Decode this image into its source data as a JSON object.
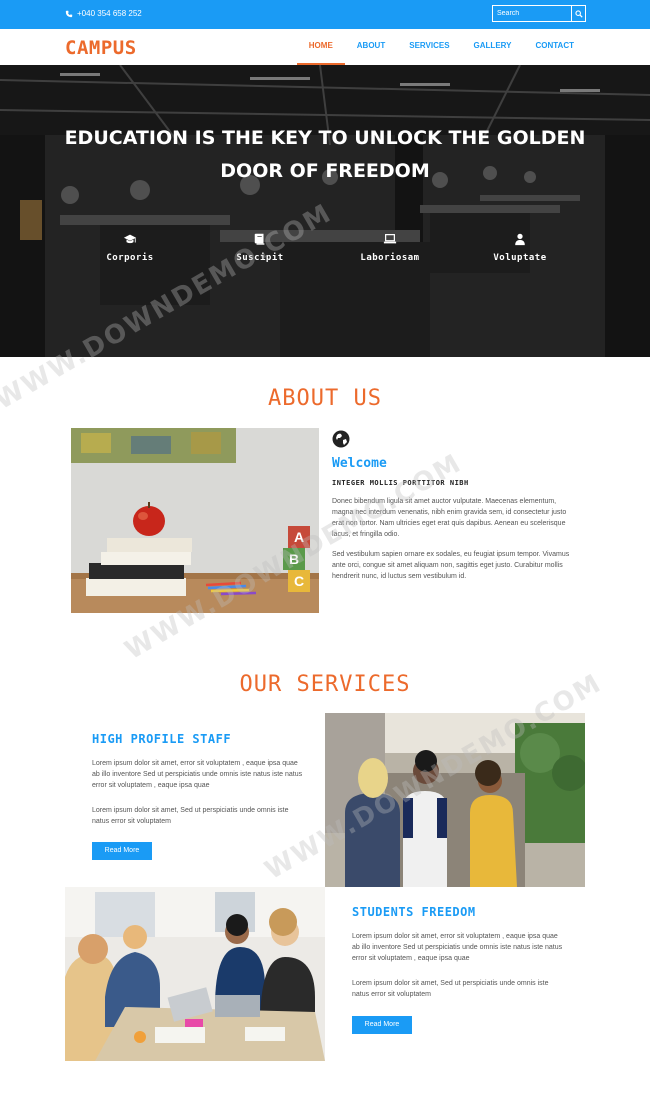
{
  "topbar": {
    "phone": "+040 354 658 252",
    "search_placeholder": "Search"
  },
  "brand": "CAMPUS",
  "nav": [
    {
      "label": "HOME",
      "active": true
    },
    {
      "label": "ABOUT",
      "active": false
    },
    {
      "label": "SERVICES",
      "active": false
    },
    {
      "label": "GALLERY",
      "active": false
    },
    {
      "label": "CONTACT",
      "active": false
    }
  ],
  "hero": {
    "title": "EDUCATION IS THE KEY TO UNLOCK THE GOLDEN DOOR OF FREEDOM",
    "features": [
      {
        "icon": "graduation-cap-icon",
        "label": "Corporis"
      },
      {
        "icon": "book-icon",
        "label": "Suscipit"
      },
      {
        "icon": "laptop-icon",
        "label": "Laboriosam"
      },
      {
        "icon": "user-icon",
        "label": "Voluptate"
      }
    ]
  },
  "about": {
    "title": "ABOUT US",
    "icon": "globe-icon",
    "welcome": "Welcome",
    "subheading": "INTEGER MOLLIS PORTTITOR NIBH",
    "para1": "Donec bibendum ligula sit amet auctor vulputate. Maecenas elementum, magna nec interdum venenatis, nibh enim gravida sem, id consectetur justo erat non tortor. Nam ultricies eget erat quis dapibus. Aenean eu scelerisque lacus, et fringilla odio.",
    "para2": "Sed vestibulum sapien ornare ex sodales, eu feugiat ipsum tempor. Vivamus ante orci, congue sit amet aliquam non, sagittis eget justo. Curabitur mollis hendrerit nunc, id luctus sem vestibulum id."
  },
  "services": {
    "title": "OUR SERVICES",
    "items": [
      {
        "title": "HIGH PROFILE STAFF",
        "para1": "Lorem ipsum dolor sit amet, error sit voluptatem , eaque ipsa quae ab illo inventore Sed ut perspiciatis unde omnis iste natus iste natus error sit voluptatem , eaque ipsa quae",
        "para2": "Lorem ipsum dolor sit amet, Sed ut perspiciatis unde omnis iste natus error sit voluptatem",
        "button": "Read More"
      },
      {
        "title": "STUDENTS FREEDOM",
        "para1": "Lorem ipsum dolor sit amet, error sit voluptatem , eaque ipsa quae ab illo inventore Sed ut perspiciatis unde omnis iste natus iste natus error sit voluptatem , eaque ipsa quae",
        "para2": "Lorem ipsum dolor sit amet, Sed ut perspiciatis unde omnis iste natus error sit voluptatem",
        "button": "Read More"
      }
    ]
  },
  "watermark": "WWW.DOWNDEMO.COM",
  "colors": {
    "accent_blue": "#1a9bf5",
    "accent_orange": "#ec6a2c"
  }
}
